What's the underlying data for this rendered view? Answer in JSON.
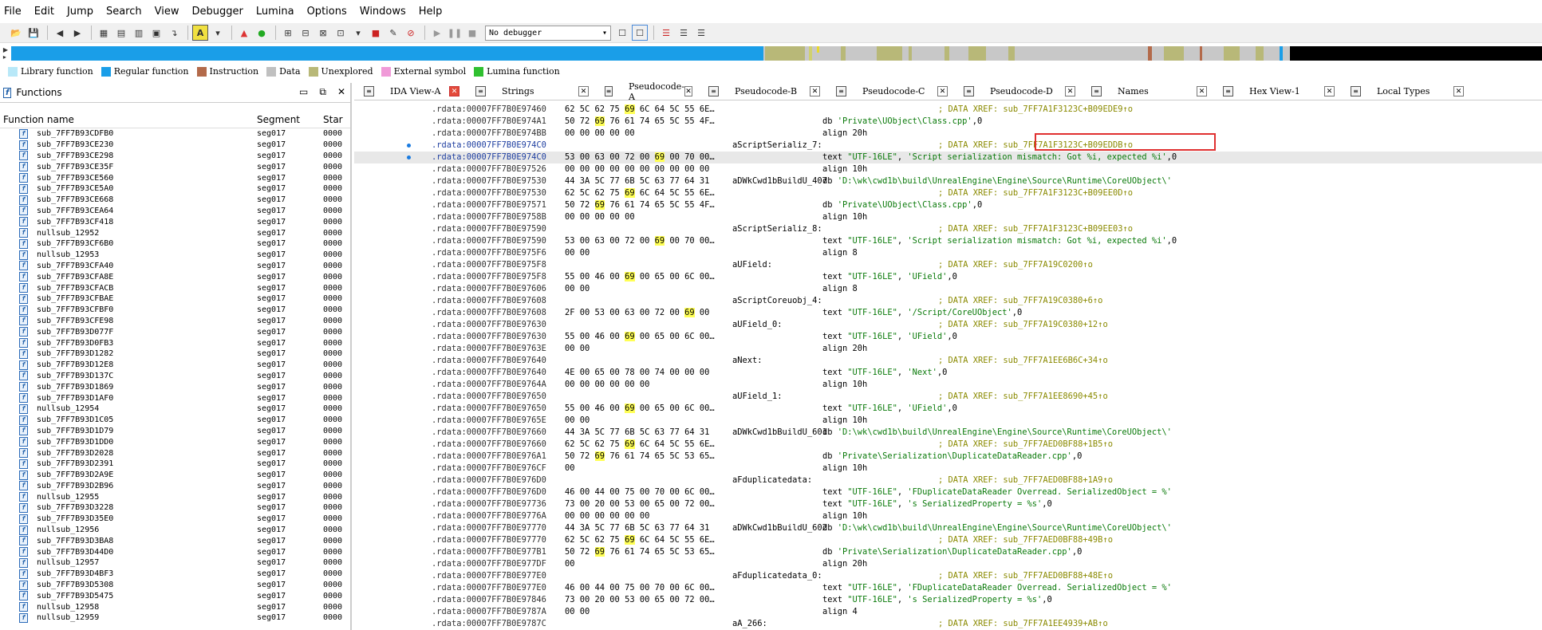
{
  "menu": [
    "File",
    "Edit",
    "Jump",
    "Search",
    "View",
    "Debugger",
    "Lumina",
    "Options",
    "Windows",
    "Help"
  ],
  "toolbar": {
    "debugger_select": "No debugger"
  },
  "legend": [
    {
      "label": "Library function",
      "color": "#b8e8f8"
    },
    {
      "label": "Regular function",
      "color": "#1a9ee8"
    },
    {
      "label": "Instruction",
      "color": "#b36a4a"
    },
    {
      "label": "Data",
      "color": "#c0c0c0"
    },
    {
      "label": "Unexplored",
      "color": "#b8b878"
    },
    {
      "label": "External symbol",
      "color": "#f09ad8"
    },
    {
      "label": "Lumina function",
      "color": "#30c030"
    }
  ],
  "functions_panel": {
    "title": "Functions",
    "columns": [
      "Function name",
      "Segment",
      "Star"
    ],
    "rows": [
      [
        "sub_7FF7B93CDFB0",
        "seg017",
        "0000"
      ],
      [
        "sub_7FF7B93CE230",
        "seg017",
        "0000"
      ],
      [
        "sub_7FF7B93CE298",
        "seg017",
        "0000"
      ],
      [
        "sub_7FF7B93CE35F",
        "seg017",
        "0000"
      ],
      [
        "sub_7FF7B93CE560",
        "seg017",
        "0000"
      ],
      [
        "sub_7FF7B93CE5A0",
        "seg017",
        "0000"
      ],
      [
        "sub_7FF7B93CE668",
        "seg017",
        "0000"
      ],
      [
        "sub_7FF7B93CEA64",
        "seg017",
        "0000"
      ],
      [
        "sub_7FF7B93CF418",
        "seg017",
        "0000"
      ],
      [
        "nullsub_12952",
        "seg017",
        "0000"
      ],
      [
        "sub_7FF7B93CF6B0",
        "seg017",
        "0000"
      ],
      [
        "nullsub_12953",
        "seg017",
        "0000"
      ],
      [
        "sub_7FF7B93CFA40",
        "seg017",
        "0000"
      ],
      [
        "sub_7FF7B93CFA8E",
        "seg017",
        "0000"
      ],
      [
        "sub_7FF7B93CFACB",
        "seg017",
        "0000"
      ],
      [
        "sub_7FF7B93CFBAE",
        "seg017",
        "0000"
      ],
      [
        "sub_7FF7B93CFBF0",
        "seg017",
        "0000"
      ],
      [
        "sub_7FF7B93CFE98",
        "seg017",
        "0000"
      ],
      [
        "sub_7FF7B93D077F",
        "seg017",
        "0000"
      ],
      [
        "sub_7FF7B93D0FB3",
        "seg017",
        "0000"
      ],
      [
        "sub_7FF7B93D1282",
        "seg017",
        "0000"
      ],
      [
        "sub_7FF7B93D12E8",
        "seg017",
        "0000"
      ],
      [
        "sub_7FF7B93D137C",
        "seg017",
        "0000"
      ],
      [
        "sub_7FF7B93D1869",
        "seg017",
        "0000"
      ],
      [
        "sub_7FF7B93D1AF0",
        "seg017",
        "0000"
      ],
      [
        "nullsub_12954",
        "seg017",
        "0000"
      ],
      [
        "sub_7FF7B93D1C05",
        "seg017",
        "0000"
      ],
      [
        "sub_7FF7B93D1D79",
        "seg017",
        "0000"
      ],
      [
        "sub_7FF7B93D1DD0",
        "seg017",
        "0000"
      ],
      [
        "sub_7FF7B93D2028",
        "seg017",
        "0000"
      ],
      [
        "sub_7FF7B93D2391",
        "seg017",
        "0000"
      ],
      [
        "sub_7FF7B93D2A9E",
        "seg017",
        "0000"
      ],
      [
        "sub_7FF7B93D2B96",
        "seg017",
        "0000"
      ],
      [
        "nullsub_12955",
        "seg017",
        "0000"
      ],
      [
        "sub_7FF7B93D3228",
        "seg017",
        "0000"
      ],
      [
        "sub_7FF7B93D35E0",
        "seg017",
        "0000"
      ],
      [
        "nullsub_12956",
        "seg017",
        "0000"
      ],
      [
        "sub_7FF7B93D3BA8",
        "seg017",
        "0000"
      ],
      [
        "sub_7FF7B93D44D0",
        "seg017",
        "0000"
      ],
      [
        "nullsub_12957",
        "seg017",
        "0000"
      ],
      [
        "sub_7FF7B93D4BF3",
        "seg017",
        "0000"
      ],
      [
        "sub_7FF7B93D5308",
        "seg017",
        "0000"
      ],
      [
        "sub_7FF7B93D5475",
        "seg017",
        "0000"
      ],
      [
        "nullsub_12958",
        "seg017",
        "0000"
      ],
      [
        "nullsub_12959",
        "seg017",
        "0000"
      ]
    ]
  },
  "tabs": [
    {
      "label": "IDA View-A",
      "active": true
    },
    {
      "label": "Strings"
    },
    {
      "label": "Pseudocode-A"
    },
    {
      "label": "Pseudocode-B"
    },
    {
      "label": "Pseudocode-C"
    },
    {
      "label": "Pseudocode-D"
    },
    {
      "label": "Names"
    },
    {
      "label": "Hex View-1"
    },
    {
      "label": "Local Types"
    }
  ],
  "code_lines": [
    {
      "addr": ".rdata:00007FF7B0E97460",
      "hex": "62 5C 62 75 69 6C 64 5C 55 6E…",
      "name": "",
      "ins": "",
      "xref": "; DATA XREF: sub_7FF7A1F3123C+B09EDE9↑o"
    },
    {
      "addr": ".rdata:00007FF7B0E974A1",
      "hex": "50 72 69 76 61 74 65 5C 55 4F…",
      "name": "",
      "ins": "db 'Private\\UObject\\Class.cpp',0",
      "xref": ""
    },
    {
      "addr": ".rdata:00007FF7B0E974BB",
      "hex": "00 00 00 00 00",
      "name": "",
      "ins": "align 20h",
      "xref": ""
    },
    {
      "addr": ".rdata:00007FF7B0E974C0",
      "hex": "",
      "name": "aScriptSerializ_7:",
      "ins": "",
      "xref": "; DATA XREF: sub_7FF7A1F3123C+B09EDDB↑o",
      "bullet": true,
      "lbl": true
    },
    {
      "addr": ".rdata:00007FF7B0E974C0",
      "hex": "53 00 63 00 72 00 69 00 70 00…",
      "name": "",
      "ins": "text \"UTF-16LE\", 'Script serialization mismatch: Got %i, expected %i',0",
      "xref": "",
      "hl": true,
      "bullet": true,
      "lbl": true
    },
    {
      "addr": ".rdata:00007FF7B0E97526",
      "hex": "00 00 00 00 00 00 00 00 00 00",
      "name": "",
      "ins": "align 10h",
      "xref": ""
    },
    {
      "addr": ".rdata:00007FF7B0E97530",
      "hex": "44 3A 5C 77 6B 5C 63 77 64 31",
      "name": "aDWkCwd1bBuildU_407",
      "ins": "db 'D:\\wk\\cwd1b\\build\\UnrealEngine\\Engine\\Source\\Runtime\\CoreUObject\\'",
      "xref": ""
    },
    {
      "addr": ".rdata:00007FF7B0E97530",
      "hex": "62 5C 62 75 69 6C 64 5C 55 6E…",
      "name": "",
      "ins": "",
      "xref": "; DATA XREF: sub_7FF7A1F3123C+B09EE0D↑o"
    },
    {
      "addr": ".rdata:00007FF7B0E97571",
      "hex": "50 72 69 76 61 74 65 5C 55 4F…",
      "name": "",
      "ins": "db 'Private\\UObject\\Class.cpp',0",
      "xref": ""
    },
    {
      "addr": ".rdata:00007FF7B0E9758B",
      "hex": "00 00 00 00 00",
      "name": "",
      "ins": "align 10h",
      "xref": ""
    },
    {
      "addr": ".rdata:00007FF7B0E97590",
      "hex": "",
      "name": "aScriptSerializ_8:",
      "ins": "",
      "xref": "; DATA XREF: sub_7FF7A1F3123C+B09EE03↑o"
    },
    {
      "addr": ".rdata:00007FF7B0E97590",
      "hex": "53 00 63 00 72 00 69 00 70 00…",
      "name": "",
      "ins": "text \"UTF-16LE\", 'Script serialization mismatch: Got %i, expected %i',0",
      "xref": ""
    },
    {
      "addr": ".rdata:00007FF7B0E975F6",
      "hex": "00 00",
      "name": "",
      "ins": "align 8",
      "xref": ""
    },
    {
      "addr": ".rdata:00007FF7B0E975F8",
      "hex": "",
      "name": "aUField:",
      "ins": "",
      "xref": "; DATA XREF: sub_7FF7A19C0200↑o"
    },
    {
      "addr": ".rdata:00007FF7B0E975F8",
      "hex": "55 00 46 00 69 00 65 00 6C 00…",
      "name": "",
      "ins": "text \"UTF-16LE\", 'UField',0",
      "xref": ""
    },
    {
      "addr": ".rdata:00007FF7B0E97606",
      "hex": "00 00",
      "name": "",
      "ins": "align 8",
      "xref": ""
    },
    {
      "addr": ".rdata:00007FF7B0E97608",
      "hex": "",
      "name": "aScriptCoreuobj_4:",
      "ins": "",
      "xref": "; DATA XREF: sub_7FF7A19C0380+6↑o"
    },
    {
      "addr": ".rdata:00007FF7B0E97608",
      "hex": "2F 00 53 00 63 00 72 00 69 00",
      "name": "",
      "ins": "text \"UTF-16LE\", '/Script/CoreUObject',0",
      "xref": ""
    },
    {
      "addr": ".rdata:00007FF7B0E97630",
      "hex": "",
      "name": "aUField_0:",
      "ins": "",
      "xref": "; DATA XREF: sub_7FF7A19C0380+12↑o"
    },
    {
      "addr": ".rdata:00007FF7B0E97630",
      "hex": "55 00 46 00 69 00 65 00 6C 00…",
      "name": "",
      "ins": "text \"UTF-16LE\", 'UField',0",
      "xref": ""
    },
    {
      "addr": ".rdata:00007FF7B0E9763E",
      "hex": "00 00",
      "name": "",
      "ins": "align 20h",
      "xref": ""
    },
    {
      "addr": ".rdata:00007FF7B0E97640",
      "hex": "",
      "name": "aNext:",
      "ins": "",
      "xref": "; DATA XREF: sub_7FF7A1EE6B6C+34↑o"
    },
    {
      "addr": ".rdata:00007FF7B0E97640",
      "hex": "4E 00 65 00 78 00 74 00 00 00",
      "name": "",
      "ins": "text \"UTF-16LE\", 'Next',0",
      "xref": ""
    },
    {
      "addr": ".rdata:00007FF7B0E9764A",
      "hex": "00 00 00 00 00 00",
      "name": "",
      "ins": "align 10h",
      "xref": ""
    },
    {
      "addr": ".rdata:00007FF7B0E97650",
      "hex": "",
      "name": "aUField_1:",
      "ins": "",
      "xref": "; DATA XREF: sub_7FF7A1EE8690+45↑o"
    },
    {
      "addr": ".rdata:00007FF7B0E97650",
      "hex": "55 00 46 00 69 00 65 00 6C 00…",
      "name": "",
      "ins": "text \"UTF-16LE\", 'UField',0",
      "xref": ""
    },
    {
      "addr": ".rdata:00007FF7B0E9765E",
      "hex": "00 00",
      "name": "",
      "ins": "align 10h",
      "xref": ""
    },
    {
      "addr": ".rdata:00007FF7B0E97660",
      "hex": "44 3A 5C 77 6B 5C 63 77 64 31",
      "name": "aDWkCwd1bBuildU_601",
      "ins": "db 'D:\\wk\\cwd1b\\build\\UnrealEngine\\Engine\\Source\\Runtime\\CoreUObject\\'",
      "xref": ""
    },
    {
      "addr": ".rdata:00007FF7B0E97660",
      "hex": "62 5C 62 75 69 6C 64 5C 55 6E…",
      "name": "",
      "ins": "",
      "xref": "; DATA XREF: sub_7FF7AED0BF88+1B5↑o"
    },
    {
      "addr": ".rdata:00007FF7B0E976A1",
      "hex": "50 72 69 76 61 74 65 5C 53 65…",
      "name": "",
      "ins": "db 'Private\\Serialization\\DuplicateDataReader.cpp',0",
      "xref": ""
    },
    {
      "addr": ".rdata:00007FF7B0E976CF",
      "hex": "00",
      "name": "",
      "ins": "align 10h",
      "xref": ""
    },
    {
      "addr": ".rdata:00007FF7B0E976D0",
      "hex": "",
      "name": "aFduplicatedata:",
      "ins": "",
      "xref": "; DATA XREF: sub_7FF7AED0BF88+1A9↑o"
    },
    {
      "addr": ".rdata:00007FF7B0E976D0",
      "hex": "46 00 44 00 75 00 70 00 6C 00…",
      "name": "",
      "ins": "text \"UTF-16LE\", 'FDuplicateDataReader Overread. SerializedObject = %'",
      "xref": ""
    },
    {
      "addr": ".rdata:00007FF7B0E97736",
      "hex": "73 00 20 00 53 00 65 00 72 00…",
      "name": "",
      "ins": "text \"UTF-16LE\", 's SerializedProperty = %s',0",
      "xref": ""
    },
    {
      "addr": ".rdata:00007FF7B0E9776A",
      "hex": "00 00 00 00 00 00",
      "name": "",
      "ins": "align 10h",
      "xref": ""
    },
    {
      "addr": ".rdata:00007FF7B0E97770",
      "hex": "44 3A 5C 77 6B 5C 63 77 64 31",
      "name": "aDWkCwd1bBuildU_602",
      "ins": "db 'D:\\wk\\cwd1b\\build\\UnrealEngine\\Engine\\Source\\Runtime\\CoreUObject\\'",
      "xref": ""
    },
    {
      "addr": ".rdata:00007FF7B0E97770",
      "hex": "62 5C 62 75 69 6C 64 5C 55 6E…",
      "name": "",
      "ins": "",
      "xref": "; DATA XREF: sub_7FF7AED0BF88+49B↑o"
    },
    {
      "addr": ".rdata:00007FF7B0E977B1",
      "hex": "50 72 69 76 61 74 65 5C 53 65…",
      "name": "",
      "ins": "db 'Private\\Serialization\\DuplicateDataReader.cpp',0",
      "xref": ""
    },
    {
      "addr": ".rdata:00007FF7B0E977DF",
      "hex": "00",
      "name": "",
      "ins": "align 20h",
      "xref": ""
    },
    {
      "addr": ".rdata:00007FF7B0E977E0",
      "hex": "",
      "name": "aFduplicatedata_0:",
      "ins": "",
      "xref": "; DATA XREF: sub_7FF7AED0BF88+48E↑o"
    },
    {
      "addr": ".rdata:00007FF7B0E977E0",
      "hex": "46 00 44 00 75 00 70 00 6C 00…",
      "name": "",
      "ins": "text \"UTF-16LE\", 'FDuplicateDataReader Overread. SerializedObject = %'",
      "xref": ""
    },
    {
      "addr": ".rdata:00007FF7B0E97846",
      "hex": "73 00 20 00 53 00 65 00 72 00…",
      "name": "",
      "ins": "text \"UTF-16LE\", 's SerializedProperty = %s',0",
      "xref": ""
    },
    {
      "addr": ".rdata:00007FF7B0E9787A",
      "hex": "00 00",
      "name": "",
      "ins": "align 4",
      "xref": ""
    },
    {
      "addr": ".rdata:00007FF7B0E9787C",
      "hex": "",
      "name": "aA_266:",
      "ins": "",
      "xref": "; DATA XREF: sub_7FF7A1EE4939+AB↑o"
    }
  ]
}
